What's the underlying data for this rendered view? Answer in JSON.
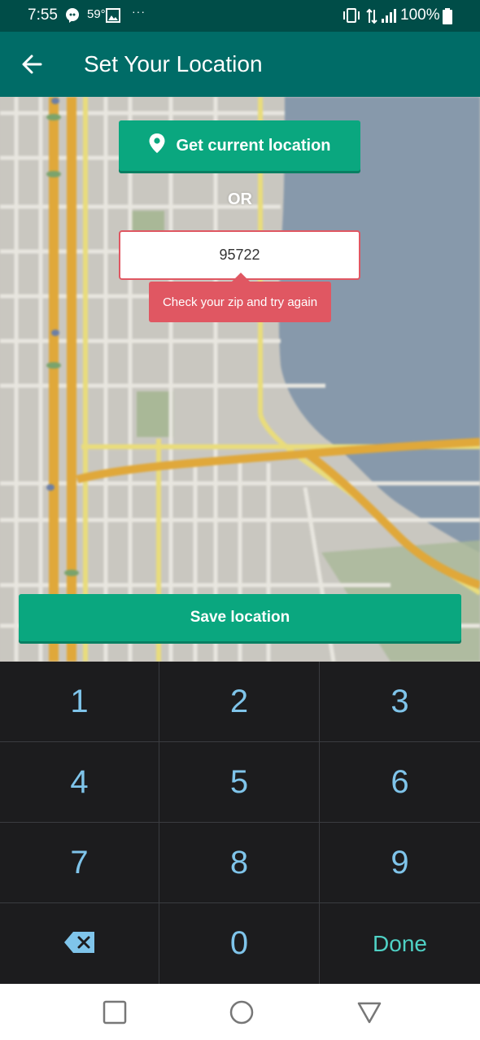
{
  "status_bar": {
    "time": "7:55",
    "temperature": "59°",
    "more": "···",
    "battery": "100%"
  },
  "app_bar": {
    "title": "Set Your Location"
  },
  "location": {
    "current_button": "Get current location",
    "or_label": "OR",
    "zip_value": "95722",
    "error_message": "Check your zip and try again",
    "save_button": "Save location"
  },
  "keypad": {
    "keys": [
      "1",
      "2",
      "3",
      "4",
      "5",
      "6",
      "7",
      "8",
      "9",
      "0"
    ],
    "done_label": "Done"
  },
  "colors": {
    "app_bar": "#006c67",
    "status_bar": "#004d48",
    "accent_green": "#0aa77f",
    "error_red": "#e05762",
    "key_text": "#7fc4ea",
    "done_text": "#4fd1c5",
    "keypad_bg": "#1c1c1e"
  }
}
